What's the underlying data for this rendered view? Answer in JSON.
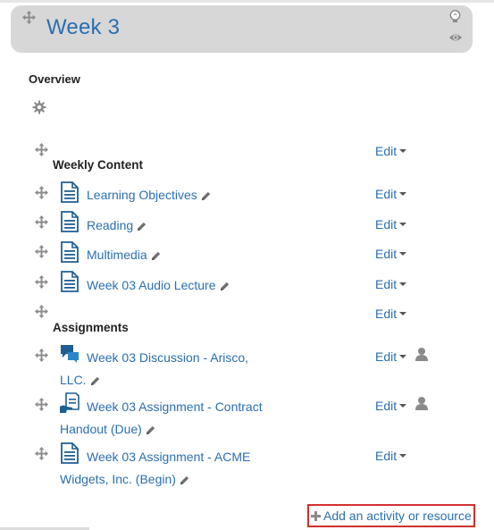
{
  "section": {
    "title": "Week 3"
  },
  "overview": {
    "label": "Overview"
  },
  "groups": [
    {
      "heading": "Weekly Content"
    },
    {
      "heading": "Assignments"
    }
  ],
  "edit_label": "Edit",
  "activities": [
    {
      "name": "Learning Objectives",
      "icon": "page-icon"
    },
    {
      "name": "Reading",
      "icon": "page-icon"
    },
    {
      "name": "Multimedia",
      "icon": "page-icon"
    },
    {
      "name": "Week 03 Audio Lecture",
      "icon": "page-icon"
    },
    {
      "line1": "Week 03 Discussion - Arisco,",
      "line2": "LLC.",
      "icon": "forum-icon"
    },
    {
      "line1": "Week 03 Assignment - Contract",
      "line2": "Handout (Due)",
      "icon": "assignment-icon"
    },
    {
      "line1": "Week 03 Assignment - ACME",
      "line2": "Widgets, Inc. (Begin)",
      "icon": "page-icon"
    }
  ],
  "add_activity": {
    "label": "Add an activity or resource"
  },
  "colors": {
    "link": "#2a6fb0",
    "header_bg": "#d7d7d7",
    "highlight_border": "#d2302f"
  }
}
